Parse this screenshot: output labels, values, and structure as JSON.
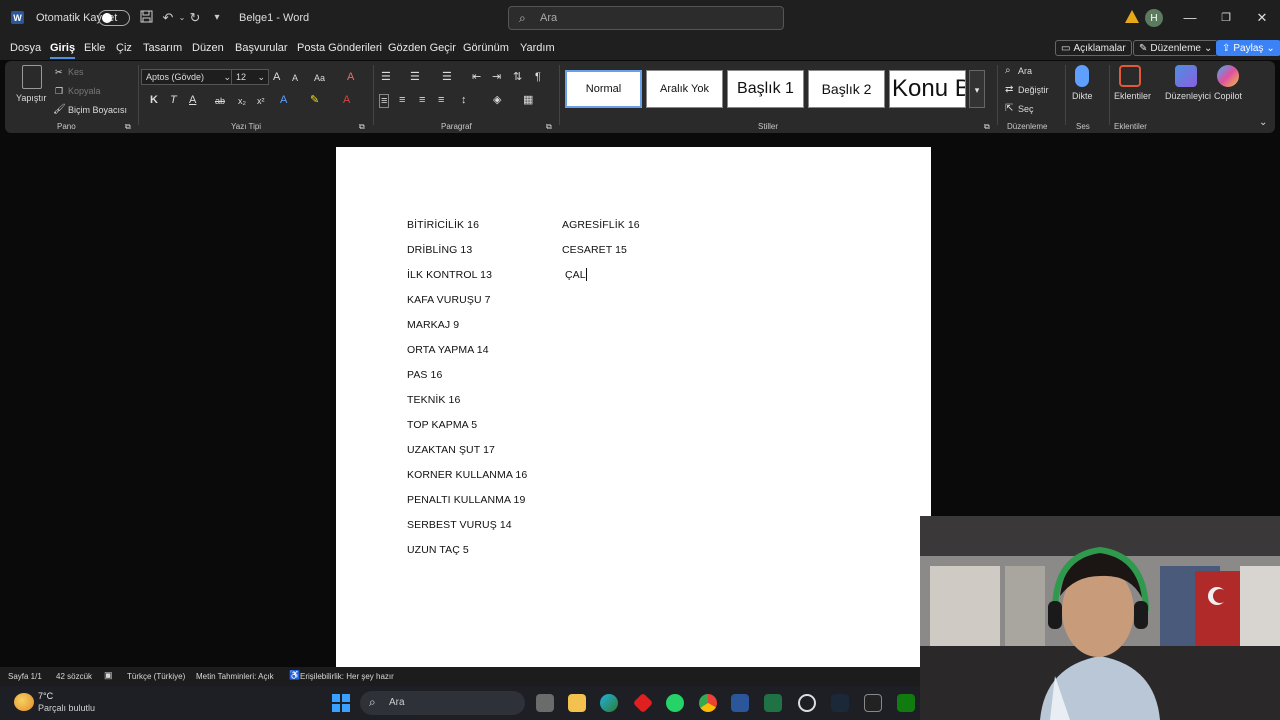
{
  "titlebar": {
    "app_letter": "W",
    "autosave_label": "Otomatik Kaydet",
    "doc_title": "Belge1 - Word",
    "search_placeholder": "Ara",
    "avatar_initial": "H"
  },
  "menu": {
    "tabs": [
      "Dosya",
      "Giriş",
      "Ekle",
      "Çiz",
      "Tasarım",
      "Düzen",
      "Başvurular",
      "Posta Gönderileri",
      "Gözden Geçir",
      "Görünüm",
      "Yardım"
    ],
    "active_tab": "Giriş",
    "comments_label": "Açıklamalar",
    "editing_label": "Düzenleme",
    "share_label": "Paylaş"
  },
  "ribbon": {
    "clipboard": {
      "paste": "Yapıştır",
      "cut": "Kes",
      "copy": "Kopyala",
      "format_painter": "Biçim Boyacısı",
      "group": "Pano"
    },
    "font": {
      "name": "Aptos (Gövde)",
      "size": "12",
      "bold": "K",
      "italic": "T",
      "underline": "A",
      "strike": "ab",
      "group": "Yazı Tipi"
    },
    "paragraph": {
      "group": "Paragraf"
    },
    "styles": {
      "items": [
        "Normal",
        "Aralık Yok",
        "Başlık 1",
        "Başlık 2",
        "Konu B"
      ],
      "group": "Stiller"
    },
    "editing": {
      "find": "Ara",
      "replace": "Değiştir",
      "select": "Seç",
      "group": "Düzenleme"
    },
    "voice": {
      "dictate": "Dikte",
      "group": "Ses"
    },
    "addins": {
      "label": "Eklentiler",
      "group": "Eklentiler"
    },
    "designer": "Düzenleyici",
    "copilot": "Copilot"
  },
  "document": {
    "left_column": [
      "BİTİRİCİLİK 16",
      "DRİBLİNG 13",
      "İLK KONTROL 13",
      "KAFA VURUŞU 7",
      "MARKAJ 9",
      "ORTA YAPMA 14",
      "PAS 16",
      "TEKNİK 16",
      "TOP KAPMA 5",
      "UZAKTAN ŞUT 17",
      "KORNER KULLANMA 16",
      "PENALTI KULLANMA 19",
      "SERBEST VURUŞ 14",
      "UZUN TAÇ 5"
    ],
    "right_column": [
      "AGRESİFLİK 16",
      "CESARET 15",
      "ÇAL"
    ]
  },
  "statusbar": {
    "page": "Sayfa 1/1",
    "words": "42 sözcük",
    "language": "Türkçe (Türkiye)",
    "predictions": "Metin Tahminleri: Açık",
    "accessibility": "Erişilebilirlik: Her şey hazır"
  },
  "taskbar": {
    "temperature": "7°C",
    "weather": "Parçalı bulutlu",
    "search_placeholder": "Ara"
  },
  "colors": {
    "word_blue": "#2b579a",
    "share_blue": "#3b82f6",
    "warning": "#e6a817"
  }
}
